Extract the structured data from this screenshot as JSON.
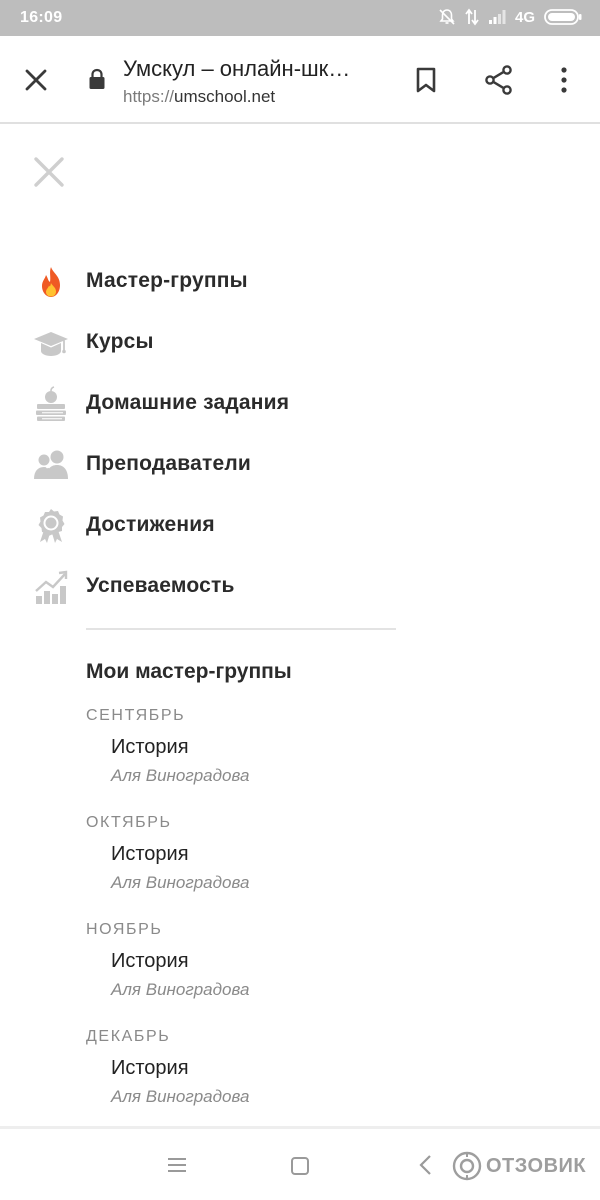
{
  "status_bar": {
    "time": "16:09",
    "network": "4G",
    "icons": [
      "mute-icon",
      "data-arrows-icon",
      "signal-icon",
      "battery-icon"
    ]
  },
  "browser": {
    "page_title": "Умскул – онлайн-шк…",
    "url_scheme": "https://",
    "url_host": "umschool.net",
    "icons": [
      "close-icon",
      "lock-icon",
      "bookmark-icon",
      "share-icon",
      "more-vert-icon"
    ]
  },
  "menu": {
    "items": [
      {
        "label": "Мастер-группы",
        "icon": "fire-icon"
      },
      {
        "label": "Курсы",
        "icon": "graduation-cap-icon"
      },
      {
        "label": "Домашние задания",
        "icon": "books-apple-icon"
      },
      {
        "label": "Преподаватели",
        "icon": "teachers-icon"
      },
      {
        "label": "Достижения",
        "icon": "award-icon"
      },
      {
        "label": "Успеваемость",
        "icon": "progress-chart-icon"
      }
    ],
    "section_title": "Мои мастер-группы",
    "groups": [
      {
        "month": "СЕНТЯБРЬ",
        "course": "История",
        "teacher": "Аля Виноградова"
      },
      {
        "month": "ОКТЯБРЬ",
        "course": "История",
        "teacher": "Аля Виноградова"
      },
      {
        "month": "НОЯБРЬ",
        "course": "История",
        "teacher": "Аля Виноградова"
      },
      {
        "month": "ДЕКАБРЬ",
        "course": "История",
        "teacher": "Аля Виноградова"
      }
    ]
  },
  "system_nav": {
    "icons": [
      "menu-lines-icon",
      "home-square-icon",
      "back-chevron-icon"
    ]
  },
  "watermark": {
    "text": "ОТЗОВИК"
  },
  "colors": {
    "status_bar": "#bdbdbd",
    "fire_icon": "#ef5a24",
    "muted_icon": "#c8c8c8",
    "text_primary": "#2b2b2b",
    "text_secondary": "#8a8a8a"
  }
}
